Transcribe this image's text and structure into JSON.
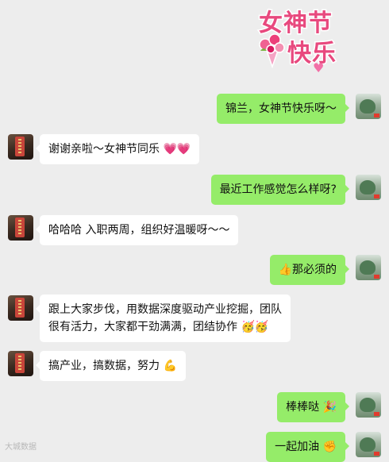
{
  "sticker": {
    "line1": "女神节",
    "line2": "快乐",
    "heart": "♥",
    "flower_icon": "bouquet-icon"
  },
  "messages": [
    {
      "side": "right",
      "text": "锦兰，女神节快乐呀～"
    },
    {
      "side": "left",
      "text": "谢谢亲啦～女神节同乐 💗💗"
    },
    {
      "side": "right",
      "text": "最近工作感觉怎么样呀?"
    },
    {
      "side": "left",
      "text": "哈哈哈 入职两周，组织好温暖呀～～"
    },
    {
      "side": "right",
      "text": "👍那必须的"
    },
    {
      "side": "left",
      "lines": [
        "跟上大家步伐，用数据深度驱动产业挖掘，团队",
        "很有活力，大家都干劲满满，团结协作 🥳🥳"
      ]
    },
    {
      "side": "left",
      "text": "搞产业，搞数据，努力 💪"
    },
    {
      "side": "right",
      "text": "棒棒哒 🎉"
    },
    {
      "side": "right",
      "text": "一起加油 ✊"
    }
  ],
  "watermark": "大城数据",
  "colors": {
    "background": "#ededed",
    "bubble_right": "#95ec69",
    "bubble_left": "#ffffff",
    "sticker_text": "#e8497e"
  }
}
